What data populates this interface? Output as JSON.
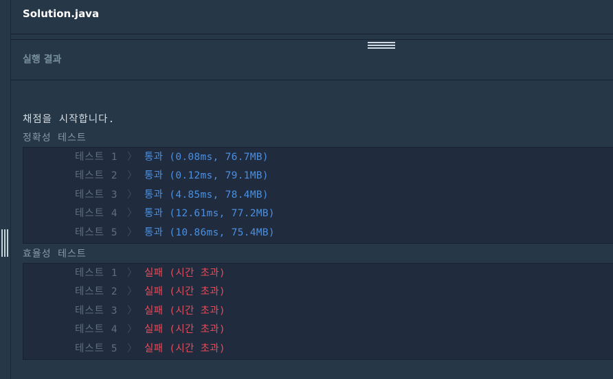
{
  "header": {
    "file_name": "Solution.java"
  },
  "result_panel": {
    "title": "실행 결과"
  },
  "console": {
    "start_message": "채점을 시작합니다.",
    "accuracy": {
      "label": "정확성  테스트",
      "rows": [
        {
          "name": "테스트 1",
          "chevron": "〉",
          "result": "통과 (0.08ms, 76.7MB)",
          "status": "pass"
        },
        {
          "name": "테스트 2",
          "chevron": "〉",
          "result": "통과 (0.12ms, 79.1MB)",
          "status": "pass"
        },
        {
          "name": "테스트 3",
          "chevron": "〉",
          "result": "통과 (4.85ms, 78.4MB)",
          "status": "pass"
        },
        {
          "name": "테스트 4",
          "chevron": "〉",
          "result": "통과 (12.61ms, 77.2MB)",
          "status": "pass"
        },
        {
          "name": "테스트 5",
          "chevron": "〉",
          "result": "통과 (10.86ms, 75.4MB)",
          "status": "pass"
        }
      ]
    },
    "efficiency": {
      "label": "효율성  테스트",
      "rows": [
        {
          "name": "테스트 1",
          "chevron": "〉",
          "result": "실패 (시간 초과)",
          "status": "fail"
        },
        {
          "name": "테스트 2",
          "chevron": "〉",
          "result": "실패 (시간 초과)",
          "status": "fail"
        },
        {
          "name": "테스트 3",
          "chevron": "〉",
          "result": "실패 (시간 초과)",
          "status": "fail"
        },
        {
          "name": "테스트 4",
          "chevron": "〉",
          "result": "실패 (시간 초과)",
          "status": "fail"
        },
        {
          "name": "테스트 5",
          "chevron": "〉",
          "result": "실패 (시간 초과)",
          "status": "fail"
        }
      ]
    }
  },
  "colors": {
    "pass": "#4a90e2",
    "fail": "#e84b5a",
    "background": "#263747",
    "console_block": "#202b3d"
  }
}
